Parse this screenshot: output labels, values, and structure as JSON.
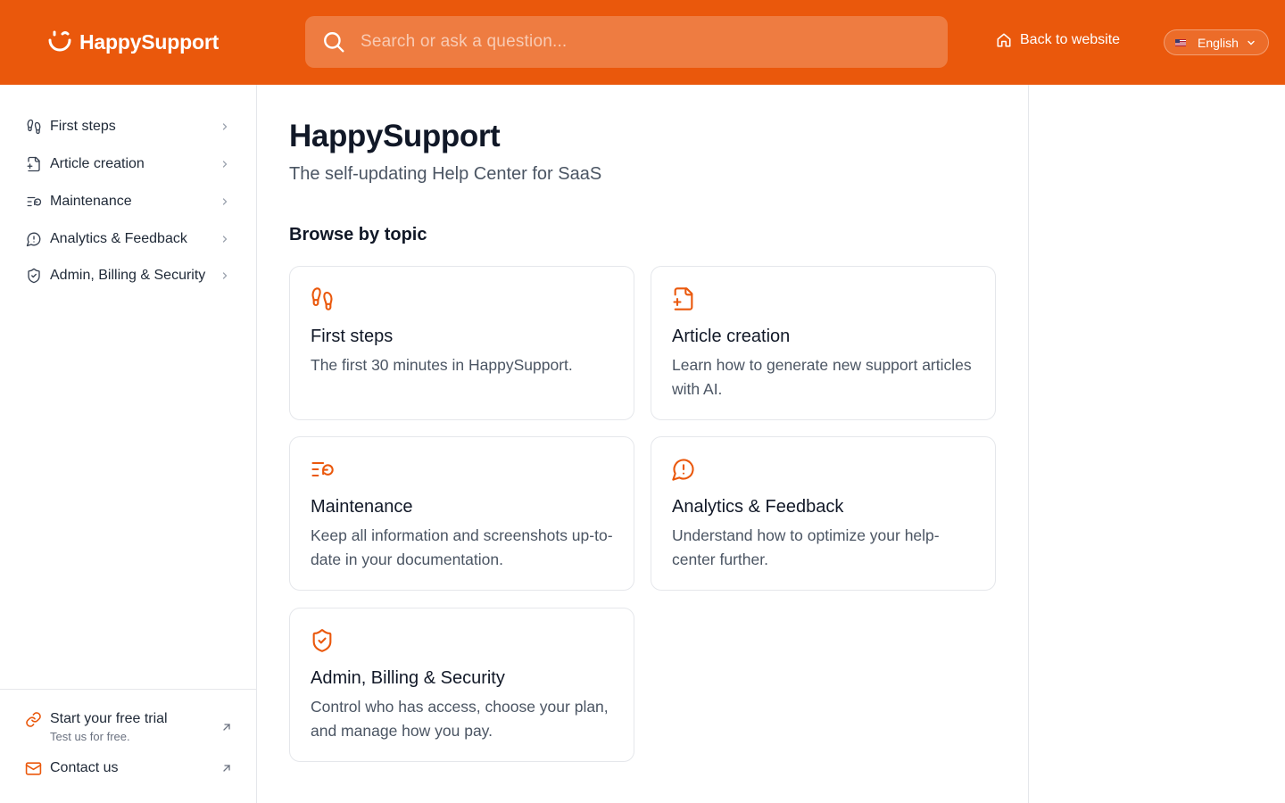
{
  "header": {
    "brand": "HappySupport",
    "search_placeholder": "Search or ask a question...",
    "back_link": "Back to website",
    "language": "English",
    "bg_color": "#ea580c"
  },
  "sidebar": {
    "items": [
      {
        "label": "First steps",
        "icon": "footprints-icon"
      },
      {
        "label": "Article creation",
        "icon": "file-plus-icon"
      },
      {
        "label": "Maintenance",
        "icon": "list-refresh-icon"
      },
      {
        "label": "Analytics & Feedback",
        "icon": "message-alert-icon"
      },
      {
        "label": "Admin, Billing & Security",
        "icon": "shield-check-icon"
      }
    ],
    "footer": {
      "trial_title": "Start your free trial",
      "trial_sub": "Test us for free.",
      "contact": "Contact us"
    }
  },
  "main": {
    "title": "HappySupport",
    "subtitle": "The self-updating Help Center for SaaS",
    "section_title": "Browse by topic",
    "cards": [
      {
        "title": "First steps",
        "desc": "The first 30 minutes in HappySupport.",
        "icon": "footprints-icon"
      },
      {
        "title": "Article creation",
        "desc": "Learn how to generate new support articles with AI.",
        "icon": "file-plus-icon"
      },
      {
        "title": "Maintenance",
        "desc": "Keep all information and screenshots up-to-date in your documentation.",
        "icon": "list-refresh-icon"
      },
      {
        "title": "Analytics & Feedback",
        "desc": "Understand how to optimize your help-center further.",
        "icon": "message-alert-icon"
      },
      {
        "title": "Admin, Billing & Security",
        "desc": "Control who has access, choose your plan, and manage how you pay.",
        "icon": "shield-check-icon"
      }
    ]
  },
  "colors": {
    "accent": "#ea580c",
    "text_primary": "#111827",
    "text_secondary": "#4b5563",
    "border": "#e5e7eb"
  }
}
